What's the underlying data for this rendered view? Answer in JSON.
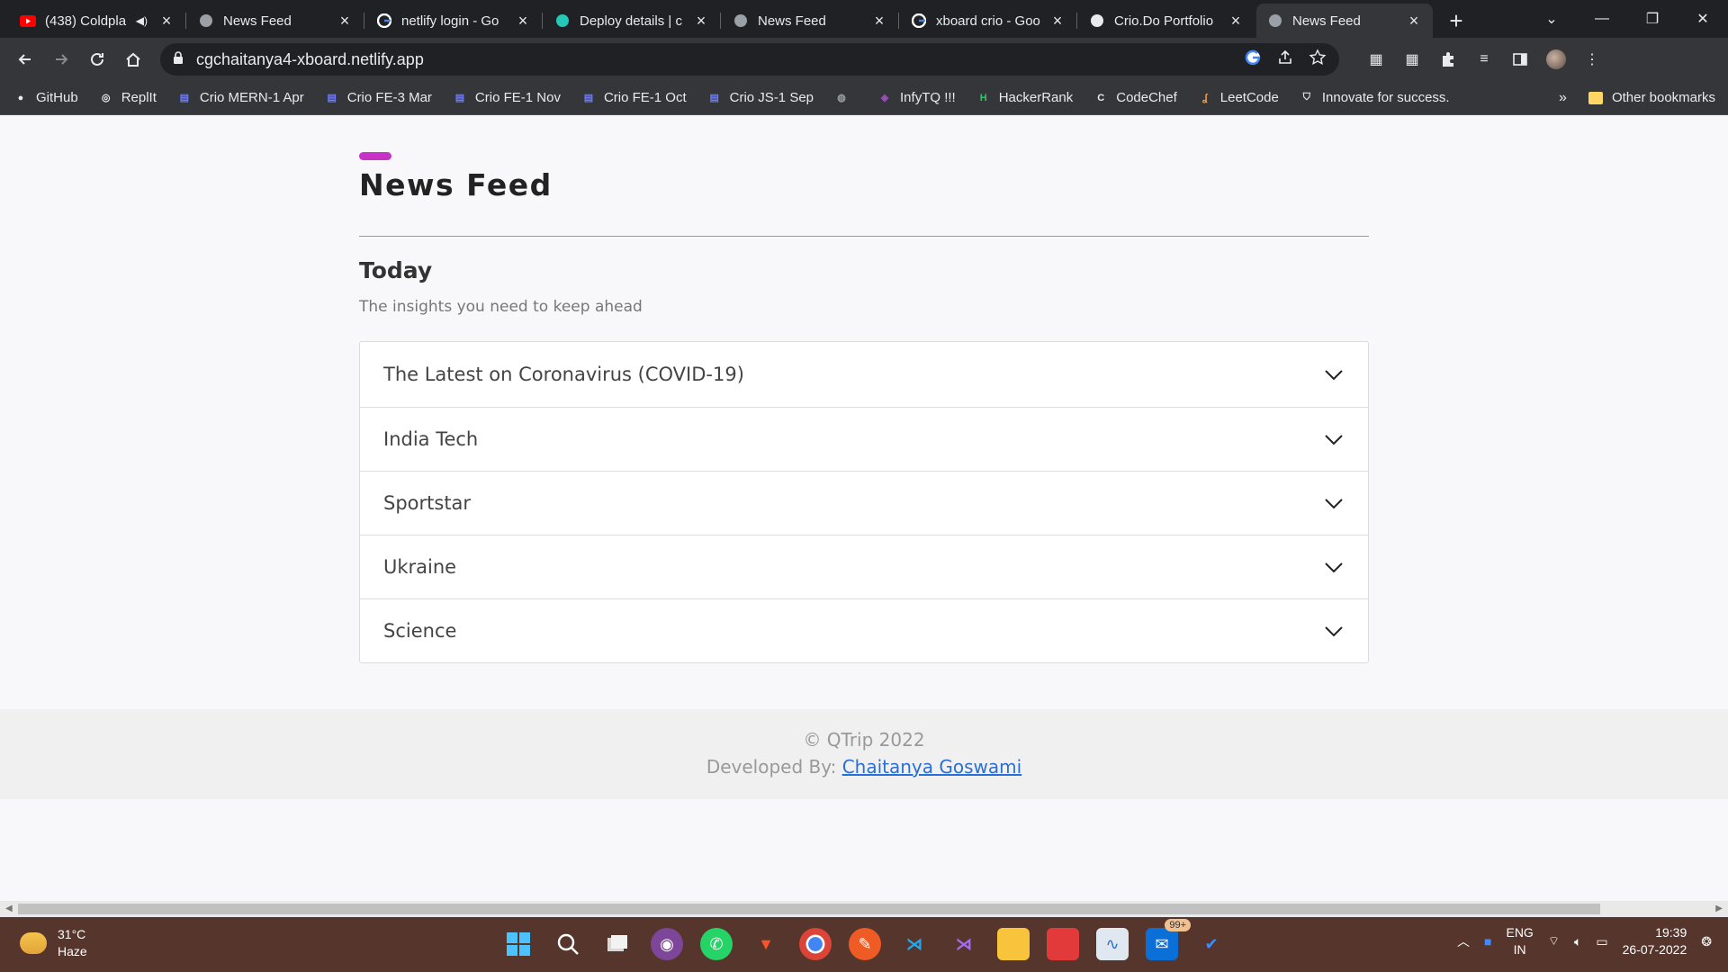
{
  "browser": {
    "tabs": [
      {
        "title": "(438) Coldpla",
        "favicon": "youtube-icon",
        "audio": true,
        "active": false
      },
      {
        "title": "News Feed",
        "favicon": "globe-icon",
        "active": false
      },
      {
        "title": "netlify login - Go",
        "favicon": "google-icon",
        "active": false
      },
      {
        "title": "Deploy details | c",
        "favicon": "netlify-icon",
        "active": false
      },
      {
        "title": "News Feed",
        "favicon": "globe-icon",
        "active": false
      },
      {
        "title": "xboard crio - Goo",
        "favicon": "google-icon",
        "active": false
      },
      {
        "title": "Crio.Do Portfolio",
        "favicon": "crio-icon",
        "active": false
      },
      {
        "title": "News Feed",
        "favicon": "globe-icon",
        "active": true
      }
    ],
    "url": "cgchaitanya4-xboard.netlify.app",
    "bookmarks": [
      {
        "label": "GitHub",
        "icon": "github-icon"
      },
      {
        "label": "ReplIt",
        "icon": "replit-icon"
      },
      {
        "label": "Crio MERN-1 Apr",
        "icon": "crio-icon"
      },
      {
        "label": "Crio FE-3 Mar",
        "icon": "crio-icon"
      },
      {
        "label": "Crio FE-1 Nov",
        "icon": "crio-icon"
      },
      {
        "label": "Crio FE-1 Oct",
        "icon": "crio-icon"
      },
      {
        "label": "Crio JS-1 Sep",
        "icon": "crio-icon"
      },
      {
        "label": "",
        "icon": "globe-icon"
      },
      {
        "label": "InfyTQ !!!",
        "icon": "infytq-icon"
      },
      {
        "label": "HackerRank",
        "icon": "hackerrank-icon"
      },
      {
        "label": "CodeChef",
        "icon": "codechef-icon"
      },
      {
        "label": "LeetCode",
        "icon": "leetcode-icon"
      },
      {
        "label": "Innovate for success.",
        "icon": "shield-icon"
      }
    ],
    "more_bookmarks": "»",
    "other_bookmarks": "Other bookmarks"
  },
  "page": {
    "title": "News Feed",
    "section_title": "Today",
    "section_subtitle": "The insights you need to keep ahead",
    "accordion": [
      "The Latest on Coronavirus (COVID-19)",
      "India Tech",
      "Sportstar",
      "Ukraine",
      "Science"
    ],
    "footer": {
      "copyright": "© QTrip 2022",
      "developed_by": "Developed By:",
      "developer": "Chaitanya Goswami"
    }
  },
  "taskbar": {
    "temperature": "31°C",
    "weather": "Haze",
    "language": "ENG",
    "region": "IN",
    "time": "19:39",
    "date": "26-07-2022",
    "mail_badge": "99+"
  },
  "colors": {
    "accent": "#c633c6",
    "link": "#2a6fd6",
    "taskbar": "#56352c",
    "chrome_dark": "#202124",
    "chrome_toolbar": "#35363a"
  }
}
